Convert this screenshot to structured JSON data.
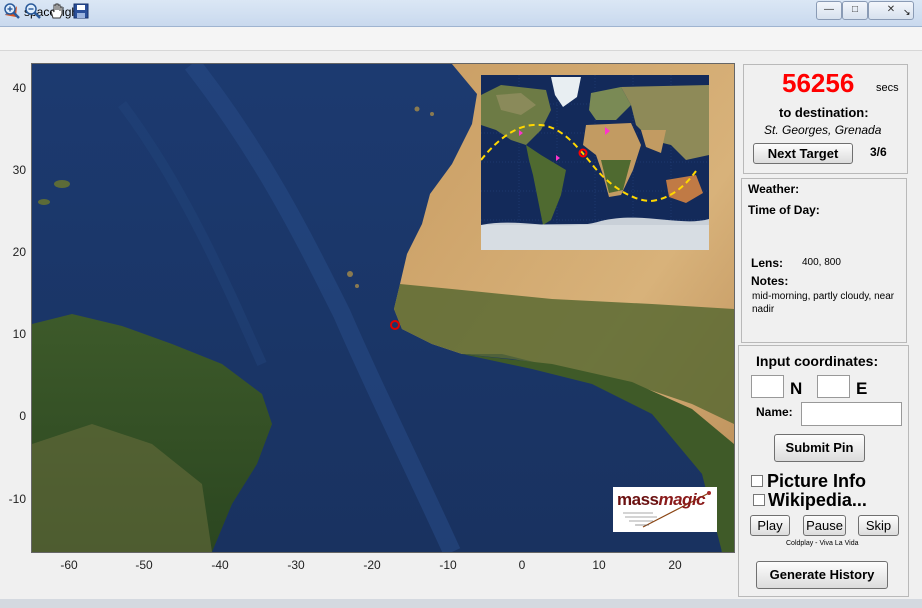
{
  "window": {
    "title": "spaceflight",
    "buttons": {
      "minimize": "—",
      "maximize": "□",
      "close": "✕"
    }
  },
  "toolbar": {
    "tools": [
      "zoom-in-icon",
      "zoom-out-icon",
      "pan-hand-icon",
      "save-icon"
    ],
    "dock_arrow": "↘"
  },
  "axes": {
    "y_ticks": [
      "40",
      "30",
      "20",
      "10",
      "0",
      "-10"
    ],
    "x_ticks": [
      "-60",
      "-50",
      "-40",
      "-30",
      "-20",
      "-10",
      "0",
      "10",
      "20"
    ],
    "xlim": [
      -66,
      27
    ],
    "ylim": [
      -16,
      43
    ]
  },
  "map": {
    "marker_lat": 11.3,
    "marker_lon": -17.8,
    "marker_color": "#e00000"
  },
  "inset": {
    "title": "",
    "path_color": "#ffd700"
  },
  "logo": {
    "text_a": "mass",
    "text_b": "magic"
  },
  "timer": {
    "count": "56256",
    "unit": "secs",
    "to_destination": "to destination:",
    "destination": "St. Georges, Grenada",
    "next_target_label": "Next Target",
    "progress": "3/6"
  },
  "info": {
    "weather_label": "Weather:",
    "time_of_day_label": "Time of Day:",
    "lens_label": "Lens:",
    "lens_value": "400, 800",
    "notes_label": "Notes:",
    "notes_text": "mid-morning, partly cloudy, near nadir"
  },
  "input": {
    "title": "Input coordinates:",
    "lat_value": "",
    "lat_label": "N",
    "lon_value": "",
    "lon_label": "E",
    "name_label": "Name:",
    "name_value": "",
    "submit_label": "Submit Pin",
    "picture_info_label": "Picture Info",
    "wikipedia_label": "Wikipedia...",
    "play_label": "Play",
    "pause_label": "Pause",
    "skip_label": "Skip",
    "song": "Coldplay - Viva La Vida",
    "generate_label": "Generate History"
  },
  "colors": {
    "counter": "#ff0000",
    "ocean": "#1e3a6e",
    "land": "#c9a064"
  }
}
